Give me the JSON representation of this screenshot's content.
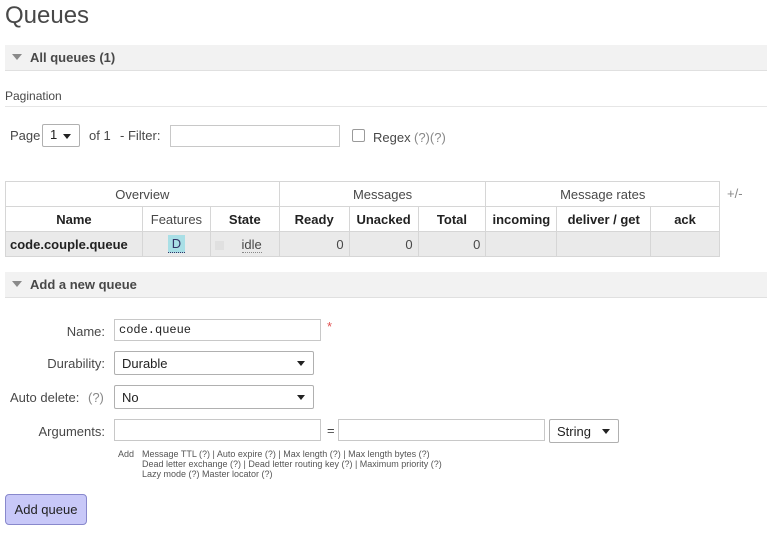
{
  "page": {
    "title": "Queues"
  },
  "all_queues": {
    "header": "All queues (1)"
  },
  "pagination": {
    "label": "Pagination",
    "page_label": "Page",
    "page_value": "1",
    "of_label": "of 1",
    "filter_label": "- Filter:",
    "filter_value": "",
    "regex_label": "Regex",
    "regex_help": "(?)(?)"
  },
  "table": {
    "groups": [
      "Overview",
      "Messages",
      "Message rates"
    ],
    "plus_minus": "+/-",
    "columns": [
      "Name",
      "Features",
      "State",
      "Ready",
      "Unacked",
      "Total",
      "incoming",
      "deliver / get",
      "ack"
    ],
    "rows": [
      {
        "name": "code.couple.queue",
        "feature": "D",
        "state": "idle",
        "ready": "0",
        "unacked": "0",
        "total": "0",
        "incoming": "",
        "deliver_get": "",
        "ack": ""
      }
    ]
  },
  "add_queue": {
    "header": "Add a new queue",
    "name_label": "Name:",
    "name_value": "code.queue",
    "required_mark": "*",
    "durability_label": "Durability:",
    "durability_value": "Durable",
    "auto_delete_label": "Auto delete:",
    "auto_delete_help": "(?)",
    "auto_delete_value": "No",
    "arguments_label": "Arguments:",
    "equals": "=",
    "arg_type_value": "String",
    "add_label": "Add",
    "hint_line1": "Message TTL (?) | Auto expire (?) | Max length (?) | Max length bytes (?)",
    "hint_line2": "Dead letter exchange (?) | Dead letter routing key (?) | Maximum priority (?)",
    "hint_line3": "Lazy mode (?) Master locator (?)",
    "submit_label": "Add queue"
  },
  "colors": {
    "feature_badge": "#a9dfe6",
    "button_bg": "#c8c8f8",
    "button_border": "#8888cc",
    "required": "#e05050"
  }
}
